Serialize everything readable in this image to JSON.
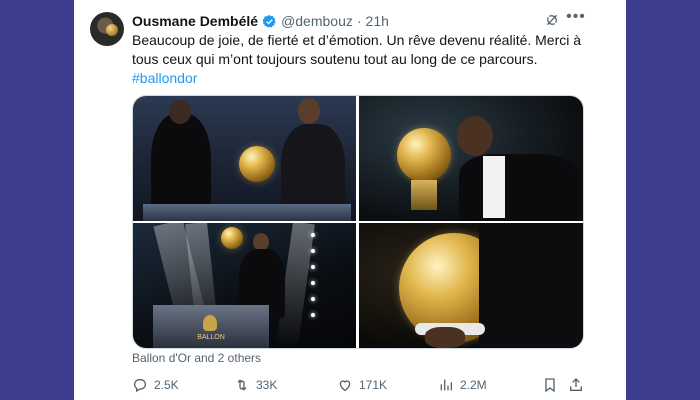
{
  "tweet": {
    "author_name": "Ousmane Dembélé",
    "handle": "@dembouz",
    "separator": "·",
    "time": "21h",
    "text": "Beaucoup de joie, de fierté et d’émotion. Un rêve devenu réalité. Merci à tous ceux qui m’ont toujours soutenu tout au long de ce parcours.",
    "hashtag": "#ballondor",
    "media_source": "Ballon d'Or and 2 others",
    "podium_text": "BALLON"
  },
  "actions": {
    "replies": "2.5K",
    "reposts": "33K",
    "likes": "171K",
    "views": "2.2M"
  },
  "icons": [
    "verified-badge-icon",
    "grok-icon",
    "more-icon",
    "reply-icon",
    "repost-icon",
    "like-icon",
    "views-icon",
    "bookmark-icon",
    "share-icon"
  ],
  "colors": {
    "background": "#3d3d8f",
    "accent": "#1d9bf0",
    "text": "#0f1419",
    "muted": "#536471"
  }
}
